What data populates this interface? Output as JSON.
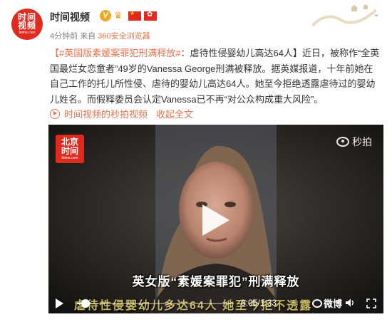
{
  "post": {
    "author": "时间视频",
    "avatar_text_line1": "时间",
    "avatar_text_line2": "视频",
    "avatar_text_line3": "btime.com",
    "verified_badge": "V",
    "time_ago": "4分钟前",
    "source_prefix": "来自",
    "source": "360安全浏览器",
    "topic": "【#英国版素媛案罪犯刑满释放#",
    "headline": "：虐待性侵婴幼儿高达64人】",
    "body": "近日，被称作“全英国最烂女恋童者”49岁的Vanessa George刑满被释放。据英媒报道，十年前她在自己工作的托儿所性侵、虐待的婴幼儿高达64人。她至今拒绝透露虐待过的婴幼儿姓名。而假释委员会认定Vanessa已不再“对公众构成重大风险”。",
    "video_link": "时间视频的秒拍视频",
    "collapse_label": "收起全文"
  },
  "video": {
    "channel_logo_line1": "北京",
    "channel_logo_line2": "时间",
    "channel_logo_line3": "btime.com",
    "watermark": "秒拍",
    "caption_top": "英女版“素媛案罪犯”刑满释放",
    "caption_bottom": "虐待性侵婴幼儿多达64人 她至今拒不透露",
    "time_display": "0:05/1:33",
    "progress": 0.054,
    "weibo_label": "微博"
  },
  "colors": {
    "accent": "#eb7350",
    "brand_red": "#e02a1f",
    "caption_yellow": "#c8ba63"
  },
  "icons": [
    "verified-icon",
    "crown-icon",
    "china-flag-icon",
    "hongkong-flag-icon",
    "chevron-down-icon",
    "play-circle-icon",
    "play-icon",
    "volume-icon",
    "fullscreen-icon"
  ]
}
